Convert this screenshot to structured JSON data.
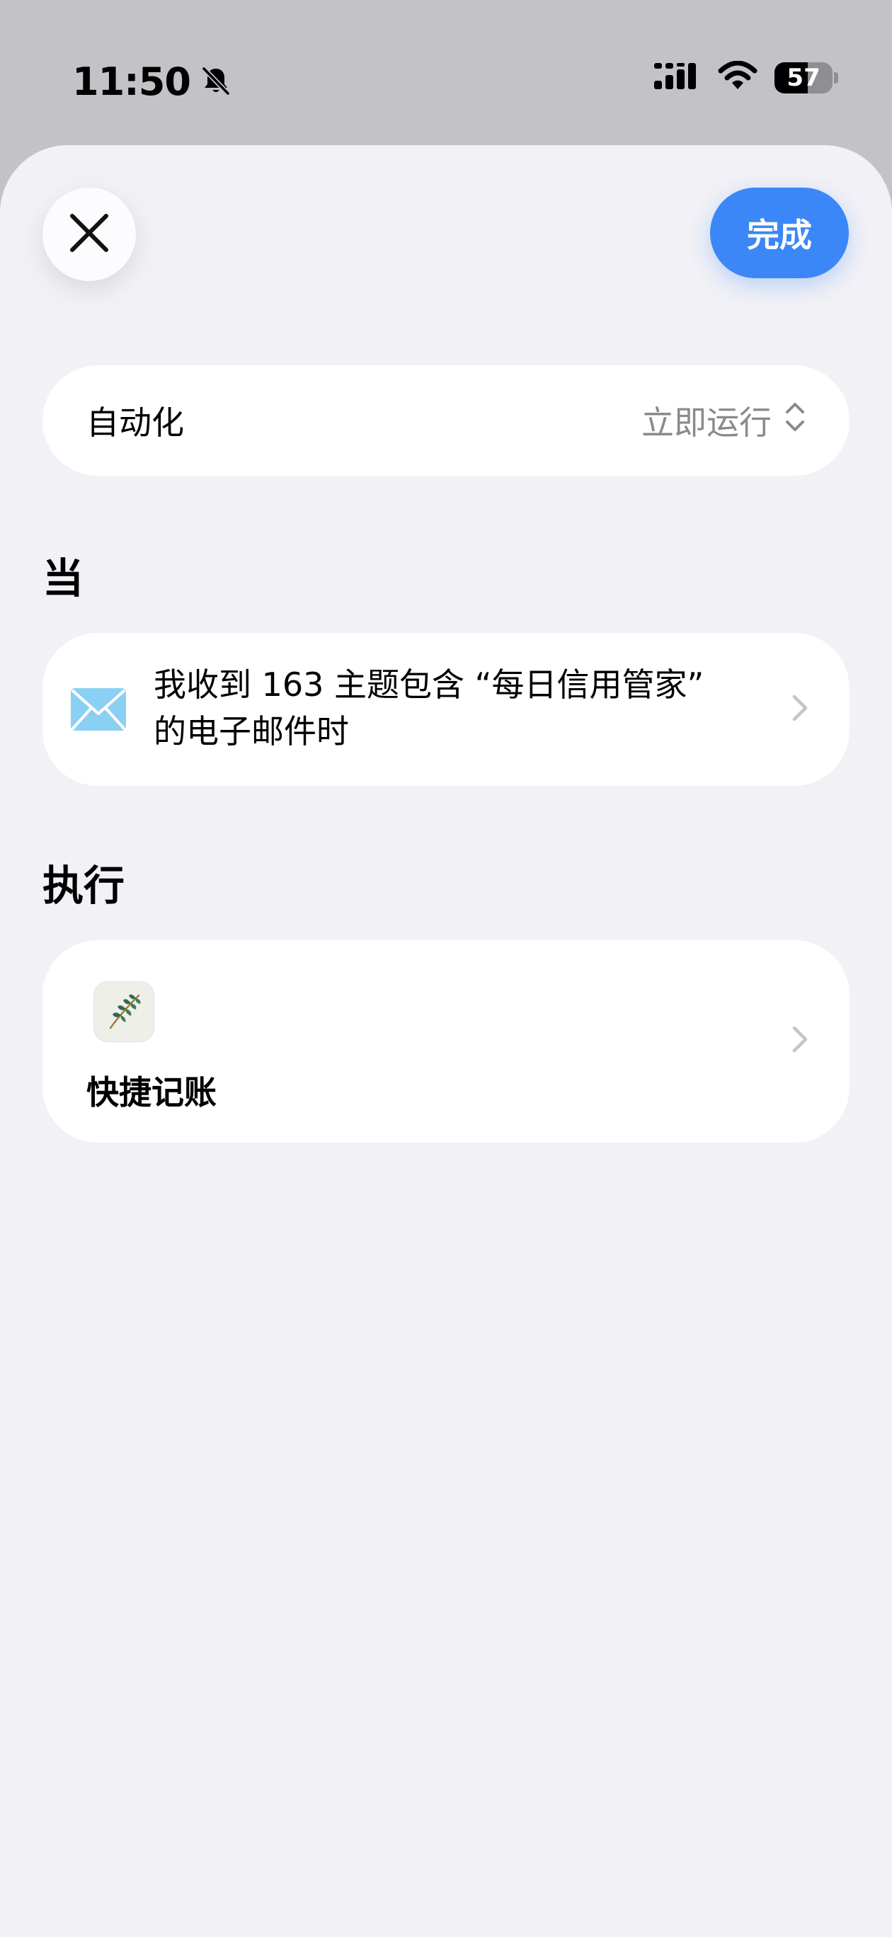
{
  "status_bar": {
    "time": "11:50",
    "battery_level": "57",
    "battery_fraction": 0.57,
    "icons": [
      "bell-slash-icon",
      "cellular-signal-icon",
      "wifi-icon",
      "battery-icon"
    ]
  },
  "header": {
    "close_icon": "close-icon",
    "done_label": "完成"
  },
  "automation": {
    "label": "自动化",
    "value": "立即运行",
    "value_icon": "chevron-up-down-icon"
  },
  "when_section": {
    "title": "当",
    "trigger": {
      "icon": "mail-icon",
      "text": "我收到 163 主题包含 “每日信用管家” 的电子邮件时"
    }
  },
  "do_section": {
    "title": "执行",
    "action": {
      "icon": "leaf-app-icon",
      "label": "快捷记账"
    }
  },
  "colors": {
    "accent": "#3b87f7",
    "sheet_background": "#f1f1f6",
    "card_background": "#ffffff",
    "secondary_text": "#8a8a8e",
    "mail_blue": "#8ad0f4"
  }
}
